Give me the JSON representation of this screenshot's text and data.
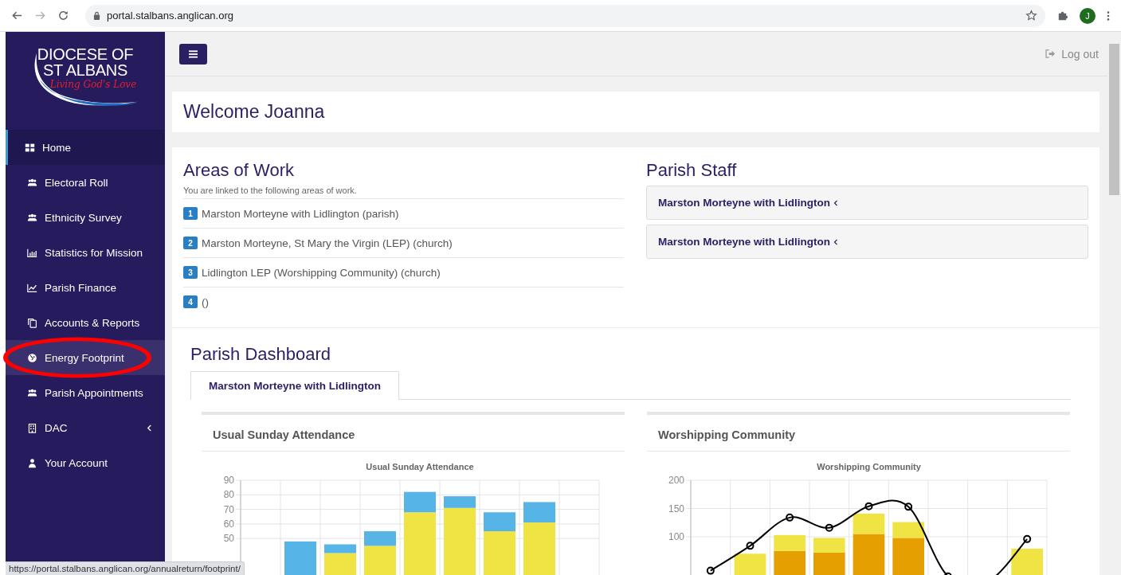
{
  "browser": {
    "url": "portal.stalbans.anglican.org",
    "avatar": "J"
  },
  "sidebar": {
    "logo": {
      "line1": "DIOCESE OF",
      "line2": "ST ALBANS",
      "tagline": "Living God's Love"
    },
    "items": [
      {
        "label": "Home",
        "selected": true,
        "hover": false,
        "circled": false,
        "has_submenu": false
      },
      {
        "label": "Electoral Roll",
        "selected": false,
        "hover": false,
        "circled": false,
        "has_submenu": false
      },
      {
        "label": "Ethnicity Survey",
        "selected": false,
        "hover": false,
        "circled": false,
        "has_submenu": false
      },
      {
        "label": "Statistics for Mission",
        "selected": false,
        "hover": false,
        "circled": false,
        "has_submenu": false
      },
      {
        "label": "Parish Finance",
        "selected": false,
        "hover": false,
        "circled": false,
        "has_submenu": false
      },
      {
        "label": "Accounts & Reports",
        "selected": false,
        "hover": false,
        "circled": false,
        "has_submenu": false
      },
      {
        "label": "Energy Footprint",
        "selected": false,
        "hover": true,
        "circled": true,
        "has_submenu": false
      },
      {
        "label": "Parish Appointments",
        "selected": false,
        "hover": false,
        "circled": false,
        "has_submenu": false
      },
      {
        "label": "DAC",
        "selected": false,
        "hover": false,
        "circled": false,
        "has_submenu": true
      },
      {
        "label": "Your Account",
        "selected": false,
        "hover": false,
        "circled": false,
        "has_submenu": false
      }
    ]
  },
  "topbar": {
    "logout": "Log out"
  },
  "welcome": "Welcome Joanna",
  "areas": {
    "title": "Areas of Work",
    "intro": "You are linked to the following areas of work.",
    "items": [
      {
        "number": "1",
        "label": "Marston Morteyne with Lidlington (parish)"
      },
      {
        "number": "2",
        "label": "Marston Morteyne, St Mary the Virgin (LEP) (church)"
      },
      {
        "number": "3",
        "label": "Lidlington LEP (Worshipping Community) (church)"
      },
      {
        "number": "4",
        "label": "()"
      }
    ]
  },
  "staff": {
    "title": "Parish Staff",
    "items": [
      {
        "label": "Marston Morteyne with Lidlington",
        "expanded": false
      },
      {
        "label": "Marston Morteyne with Lidlington",
        "expanded": false
      }
    ]
  },
  "dashboard": {
    "title": "Parish Dashboard",
    "tabs": [
      {
        "label": "Marston Morteyne with Lidlington",
        "selected": true
      }
    ],
    "cards": [
      {
        "title": "Usual Sunday Attendance",
        "chart_data": {
          "type": "bar",
          "title": "Usual Sunday Attendance",
          "stacked": true,
          "grid": true,
          "ylim": [
            0,
            90
          ],
          "yticks": [
            50,
            60,
            70,
            80,
            90
          ],
          "series": [
            {
              "color": "#efe443",
              "values": [
                null,
                null,
                40,
                45,
                68,
                71,
                55,
                61,
                null
              ]
            },
            {
              "color": "#56b4e6",
              "values": [
                null,
                48,
                6,
                10,
                14,
                8,
                13,
                14,
                null
              ]
            }
          ]
        }
      },
      {
        "title": "Worshipping Community",
        "chart_data": {
          "type": "bar",
          "title": "Worshipping Community",
          "stacked": true,
          "grid": true,
          "ylim": [
            0,
            200
          ],
          "yticks": [
            100,
            150,
            200
          ],
          "series": [
            {
              "color": "#e69f00",
              "values": [
                null,
                null,
                75,
                72,
                105,
                98,
                null,
                null,
                null
              ]
            },
            {
              "color": "#efe443",
              "values": [
                null,
                70,
                28,
                26,
                36,
                28,
                null,
                null,
                79
              ]
            },
            {
              "type": "line",
              "marker": "o",
              "color": "#000000",
              "values": [
                40,
                84,
                134,
                116,
                154,
                153,
                30,
                20,
                96
              ]
            }
          ]
        }
      }
    ]
  },
  "status_bar": "https://portal.stalbans.anglican.org/annualreturn/footprint/"
}
